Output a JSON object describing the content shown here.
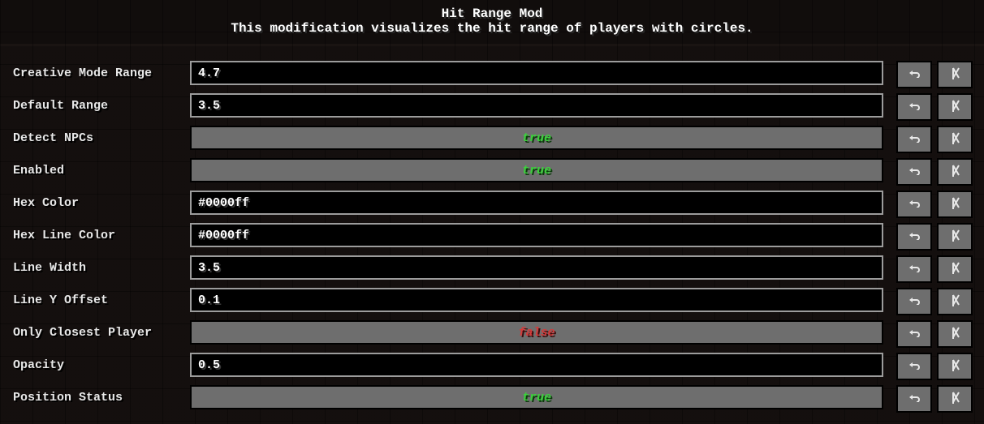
{
  "header": {
    "title": "Hit Range Mod",
    "subtitle": "This modification visualizes the hit range of players with circles."
  },
  "entries": [
    {
      "label": "Creative Mode Range",
      "type": "text",
      "value": "4.7"
    },
    {
      "label": "Default Range",
      "type": "text",
      "value": "3.5"
    },
    {
      "label": "Detect NPCs",
      "type": "bool",
      "value": "true"
    },
    {
      "label": "Enabled",
      "type": "bool",
      "value": "true"
    },
    {
      "label": "Hex Color",
      "type": "text",
      "value": "#0000ff"
    },
    {
      "label": "Hex Line Color",
      "type": "text",
      "value": "#0000ff"
    },
    {
      "label": "Line Width",
      "type": "text",
      "value": "3.5"
    },
    {
      "label": "Line Y Offset",
      "type": "text",
      "value": "0.1"
    },
    {
      "label": "Only Closest Player",
      "type": "bool",
      "value": "false"
    },
    {
      "label": "Opacity",
      "type": "text",
      "value": "0.5"
    },
    {
      "label": "Position Status",
      "type": "bool",
      "value": "true"
    }
  ],
  "icons": {
    "undo": "undo-icon",
    "reset": "reset-icon"
  }
}
